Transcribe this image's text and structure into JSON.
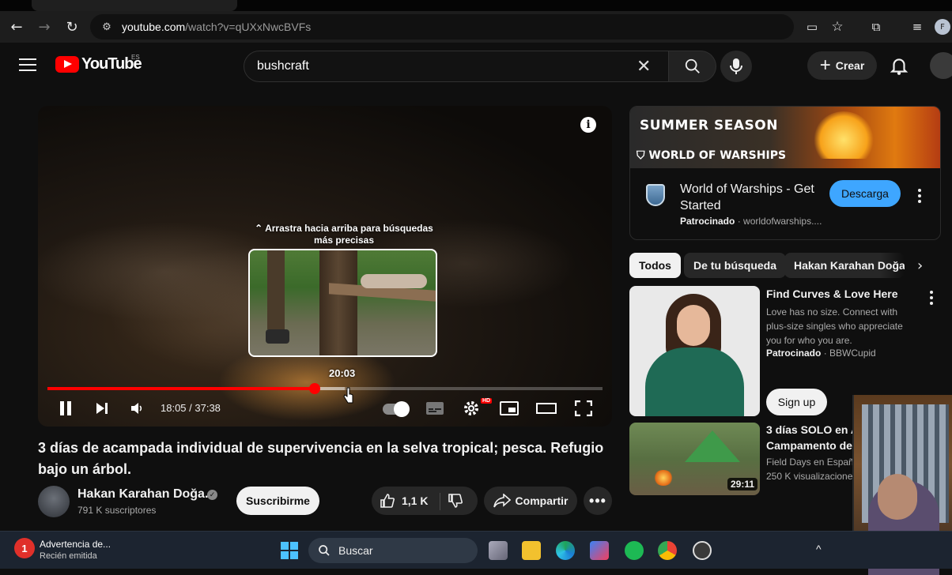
{
  "browser": {
    "url_host": "youtube.com",
    "url_path": "/watch?v=qUXxNwcBVFs"
  },
  "header": {
    "logo_text": "YouTube",
    "country_code": "ES",
    "search_value": "bushcraft",
    "create_label": "Crear"
  },
  "player": {
    "drag_hint": "Arrastra hacia arriba para búsquedas más precisas",
    "preview_time": "20:03",
    "time_display": "18:05 / 37:38",
    "progress_played_fraction": 0.4808,
    "hd_badge": "HD"
  },
  "video": {
    "title": "3 días de acampada individual de supervivencia en la selva tropical; pesca. Refugio bajo un árbol.",
    "channel_name": "Hakan Karahan Doğa...",
    "subscribers": "791 K suscriptores",
    "subscribe_label": "Suscribirme",
    "likes": "1,1 K",
    "share_label": "Compartir"
  },
  "ad": {
    "banner_line1": "SUMMER SEASON",
    "banner_line2": "WORLD OF WARSHIPS",
    "title": "World of Warships - Get Started",
    "sponsored": "Patrocinado",
    "domain": "worldofwarships....",
    "cta": "Descarga"
  },
  "chips": [
    "Todos",
    "De tu búsqueda",
    "Hakan Karahan Doğa"
  ],
  "recommendations": [
    {
      "title": "Find Curves & Love Here",
      "desc": "Love has no size. Connect with plus-size singles who appreciate you for who you are.",
      "sponsored": "Patrocinado",
      "advertiser": "BBWCupid",
      "cta": "Sign up"
    },
    {
      "title_l1": "3 días SOLO en A",
      "title_l2": "Campamento de s",
      "channel": "Field Days en Españ",
      "views": "250 K visualizacione",
      "duration": "29:11"
    }
  ],
  "taskbar": {
    "notif_badge": "1",
    "notif_title": "Advertencia de...",
    "notif_sub": "Recién emitida",
    "search_label": "Buscar"
  },
  "colors": {
    "youtube_red": "#ff0000",
    "accent_blue": "#3ea6ff"
  }
}
